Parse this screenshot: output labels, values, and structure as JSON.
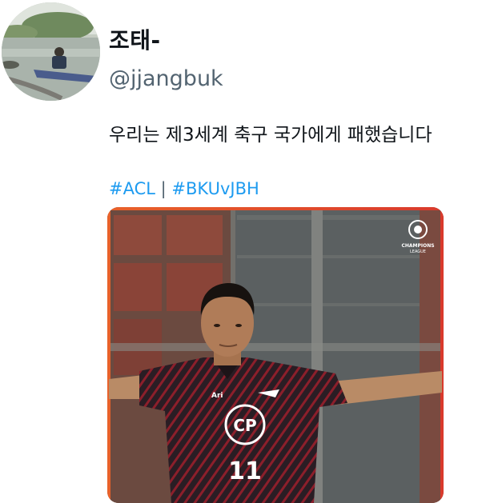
{
  "user": {
    "display_name": "조태-",
    "handle": "@jjangbuk"
  },
  "tweet": {
    "text": "우리는 제3세계 축구 국가에게 패했습니다",
    "hashtags": [
      "#ACL",
      "#BKUvJBH"
    ],
    "separator": "|"
  },
  "media": {
    "logo_text": [
      "CHAMPIONS",
      "LEAGUE"
    ],
    "jersey_sponsor": "CP",
    "jersey_number": "11",
    "kit_brand": "Ari"
  },
  "colors": {
    "hashtag": "#1d9bf0",
    "handle": "#536471",
    "text": "#0f1419"
  }
}
